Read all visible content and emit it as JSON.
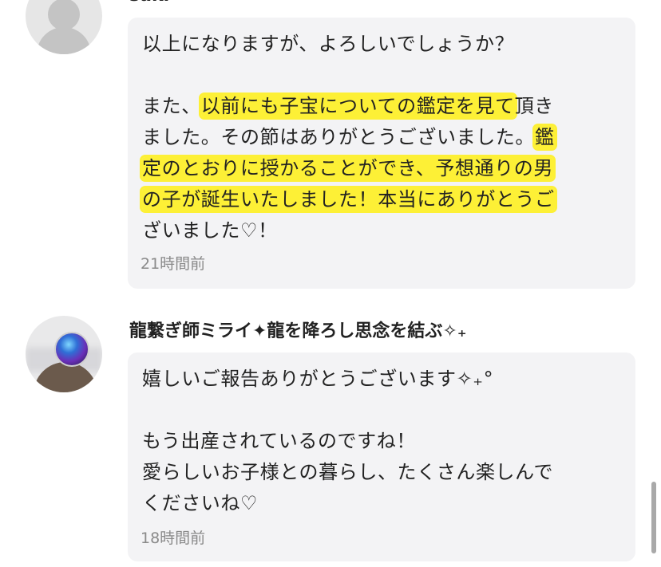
{
  "comments": [
    {
      "username": "saki",
      "lines": [
        {
          "segments": [
            {
              "text": "以上になりますが、よろしいでしょうか？",
              "highlight": false
            }
          ]
        },
        {
          "segments": [
            {
              "text": "",
              "highlight": false
            }
          ]
        },
        {
          "segments": [
            {
              "text": "また、",
              "highlight": false
            },
            {
              "text": "以前にも子宝についての鑑定を見て",
              "highlight": true
            },
            {
              "text": "頂き",
              "highlight": false
            }
          ]
        },
        {
          "segments": [
            {
              "text": "ました。その節はありがとうございました。",
              "highlight": false
            },
            {
              "text": "鑑",
              "highlight": true
            }
          ]
        },
        {
          "segments": [
            {
              "text": "定のとおりに授かることができ、予想通りの男",
              "highlight": true
            }
          ]
        },
        {
          "segments": [
            {
              "text": "の子が誕生いたしました！本当にありがとうご",
              "highlight": true
            }
          ]
        },
        {
          "segments": [
            {
              "text": "ざいました♡！",
              "highlight": false
            }
          ]
        }
      ],
      "time": "21時間前"
    },
    {
      "username": "龍繋ぎ師ミライ✦龍を降ろし思念を結ぶ✧₊",
      "lines": [
        {
          "segments": [
            {
              "text": "嬉しいご報告ありがとうございます✧₊°",
              "highlight": false
            }
          ]
        },
        {
          "segments": [
            {
              "text": "",
              "highlight": false
            }
          ]
        },
        {
          "segments": [
            {
              "text": "もう出産されているのですね！",
              "highlight": false
            }
          ]
        },
        {
          "segments": [
            {
              "text": "愛らしいお子様との暮らし、たくさん楽しんで",
              "highlight": false
            }
          ]
        },
        {
          "segments": [
            {
              "text": "くださいね♡",
              "highlight": false
            }
          ]
        }
      ],
      "time": "18時間前"
    }
  ],
  "icons": {
    "avatar1": "default-user-icon",
    "avatar2": "crystal-orb-avatar"
  },
  "colors": {
    "highlight": "#ffee00",
    "bubble": "#f3f3f5",
    "time": "#8a8a8a"
  }
}
